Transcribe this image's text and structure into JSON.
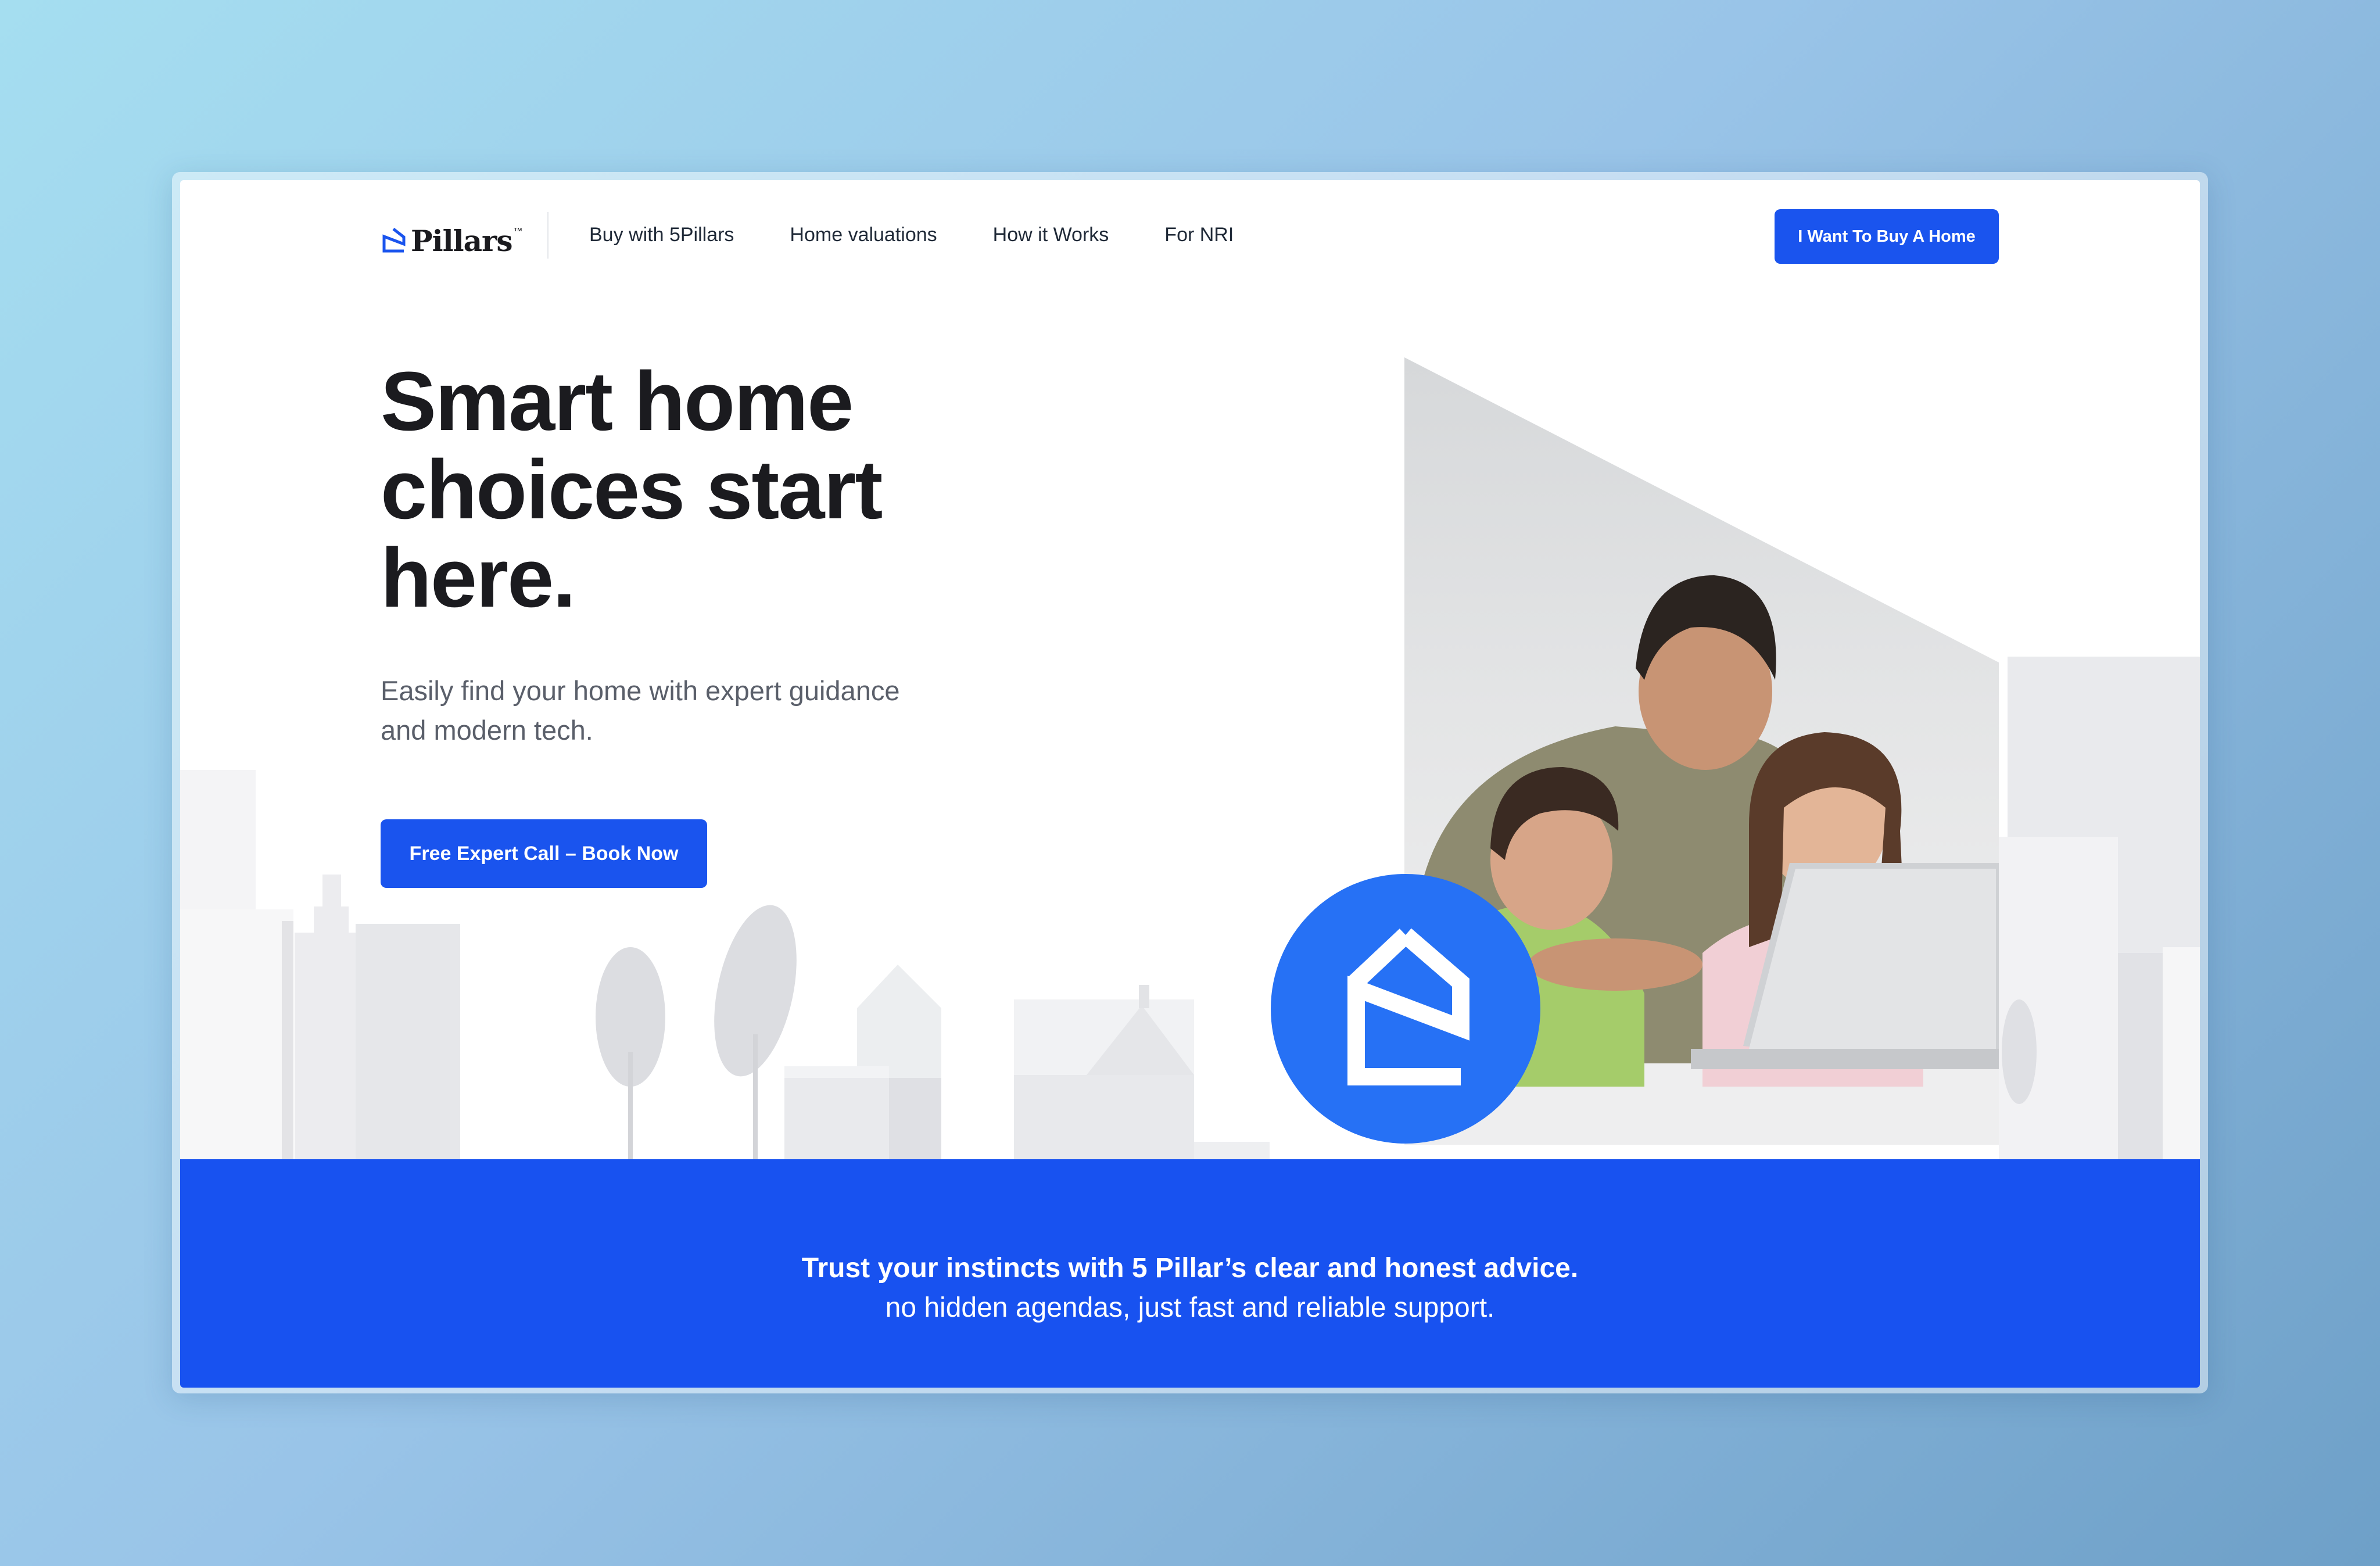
{
  "brand": {
    "name": "Pillars",
    "trademark": "™"
  },
  "nav": {
    "items": [
      {
        "label": "Buy with 5Pillars"
      },
      {
        "label": "Home valuations"
      },
      {
        "label": "How it Works"
      },
      {
        "label": "For NRI"
      }
    ],
    "cta_label": "I Want To Buy A Home"
  },
  "hero": {
    "title": "Smart home choices start here.",
    "subtitle": "Easily find your home with expert guidance and modern tech.",
    "cta_label": "Free Expert Call – Book Now"
  },
  "banner": {
    "headline": "Trust your instincts with 5 Pillar’s clear and honest advice.",
    "subline": "no hidden agendas, just fast and reliable support."
  },
  "colors": {
    "accent": "#1a54ee",
    "banner": "#1852f0",
    "badge": "#2671f5",
    "text_dark": "#1b1b1f",
    "text_muted": "#5a5f6a"
  },
  "icons": [
    "logo-house-icon",
    "badge-house-icon"
  ]
}
